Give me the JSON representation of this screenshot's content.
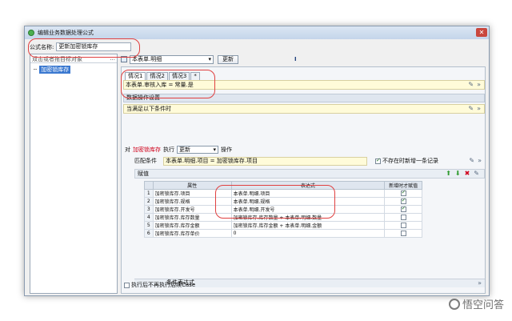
{
  "window": {
    "title": "编辑业务数据处理公式",
    "close": "✕"
  },
  "formula": {
    "label": "公式名称:",
    "value": "更新加密锁库存"
  },
  "left": {
    "search_placeholder": "双击或者拖目标对象",
    "search_btn": "...",
    "tree_item": "加密锁库存"
  },
  "toolbar": {
    "icon": "当",
    "source": "本表单.明细",
    "update_btn": "更新",
    "mark": "Ⅰ"
  },
  "tabs": [
    "情况1",
    "情况2",
    "情况3",
    "*"
  ],
  "condition": {
    "text": "本表单.审核入库 = 常量.是"
  },
  "sections": {
    "data_ops": "数据操作设置",
    "when": "当满足以下条件时"
  },
  "exec": {
    "pre": "对",
    "target": "加密锁库存",
    "mid": "执行",
    "op": "更新",
    "post": "操作"
  },
  "match": {
    "label": "匹配条件",
    "value": "本表单.明细.项目 = 加密锁库存.项目",
    "no_exist": "不存在时新增一条记录"
  },
  "assign": {
    "label": "赋值"
  },
  "grid": {
    "headers": [
      "属性",
      "表达式",
      "新增时才赋值"
    ],
    "rows": [
      {
        "n": "1",
        "attr": "加密锁库存.项目",
        "expr": "本表单.明细.项目",
        "checked": true
      },
      {
        "n": "2",
        "attr": "加密锁库存.规格",
        "expr": "本表单.明细.规格",
        "checked": true
      },
      {
        "n": "3",
        "attr": "加密锁库存.开发号",
        "expr": "本表单.明细.开发号",
        "checked": true
      },
      {
        "n": "4",
        "attr": "加密锁库存.库存数量",
        "expr": "加密锁库存.库存数量 + 本表单.明细.数量",
        "checked": false
      },
      {
        "n": "5",
        "attr": "加密锁库存.库存金额",
        "expr": "加密锁库存.库存金额 + 本表单.明细.金额",
        "checked": false
      },
      {
        "n": "6",
        "attr": "加密锁库存.库存单价",
        "expr": "0",
        "checked": false
      }
    ]
  },
  "cond_expr": {
    "label": "条件表达式"
  },
  "bottom": {
    "label": "执行后不再执行后续Case"
  },
  "watermark": {
    "text": "悟空问答"
  },
  "colors": {
    "accent_red": "#d0021b",
    "selection": "#3a78d0",
    "highlight": "#fffbd9"
  }
}
